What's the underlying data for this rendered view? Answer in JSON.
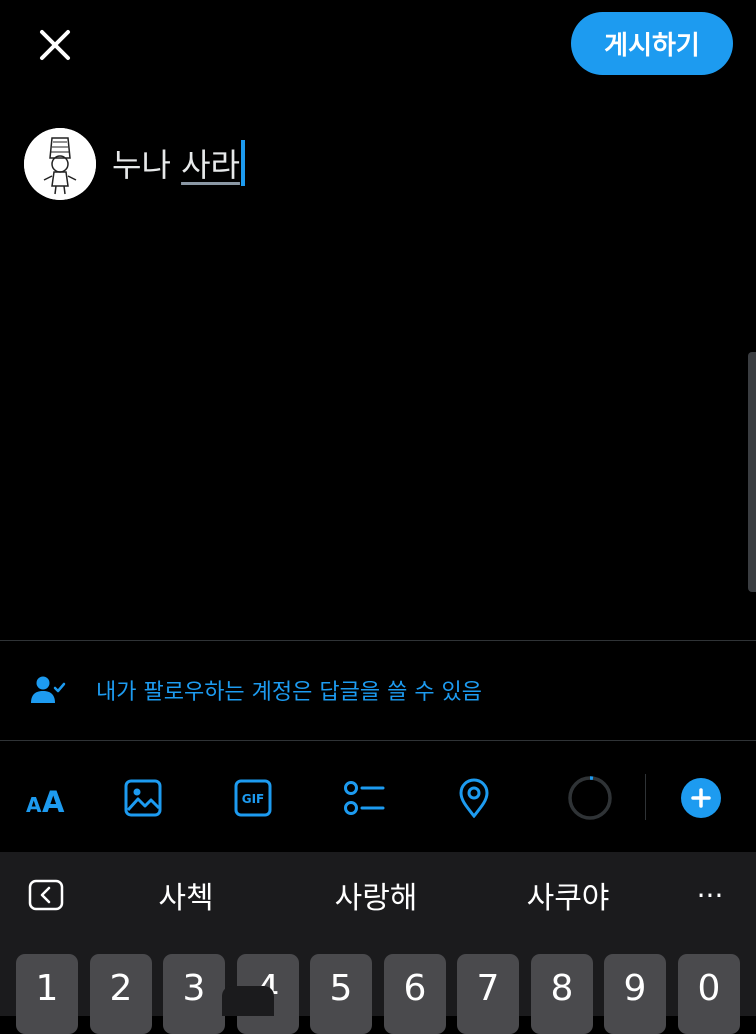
{
  "header": {
    "close_icon": "close-icon",
    "post_label": "게시하기"
  },
  "compose": {
    "committed_text": "누나 ",
    "composing_text": "사라"
  },
  "reply_setting": {
    "icon": "person-check-icon",
    "label": "내가 팔로우하는 계정은 답글을 쓸 수 있음"
  },
  "toolbar": {
    "items": [
      "text-format-icon",
      "image-icon",
      "gif-icon",
      "poll-icon",
      "location-icon",
      "character-counter-ring",
      "add-thread-icon"
    ],
    "text_format_label": "AA",
    "gif_label": "GIF"
  },
  "keyboard": {
    "suggestions": [
      "사첵",
      "사랑해",
      "사쿠야"
    ],
    "more_label": "···",
    "number_keys": [
      "1",
      "2",
      "3",
      "4",
      "5",
      "6",
      "7",
      "8",
      "9",
      "0"
    ]
  },
  "colors": {
    "accent": "#1d9bf0",
    "background": "#000000",
    "keyboard_bg": "#1b1b1d",
    "key_bg": "#4a4a4d"
  }
}
